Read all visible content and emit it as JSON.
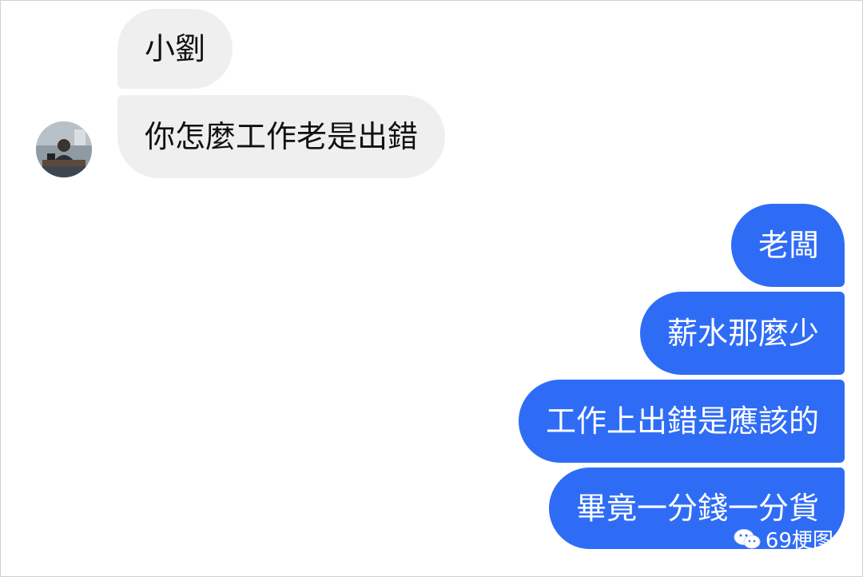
{
  "incoming": {
    "messages": [
      "小劉",
      "你怎麼工作老是出錯"
    ],
    "avatar": "sender-avatar-photo"
  },
  "outgoing": {
    "messages": [
      "老闆",
      "薪水那麼少",
      "工作上出錯是應該的",
      "畢竟一分錢一分貨"
    ]
  },
  "watermark": {
    "text": "69梗图",
    "icon": "wechat-icon"
  },
  "colors": {
    "incoming_bubble": "#efefef",
    "outgoing_bubble": "#2f6cf6",
    "incoming_text": "#111111",
    "outgoing_text": "#ffffff"
  }
}
